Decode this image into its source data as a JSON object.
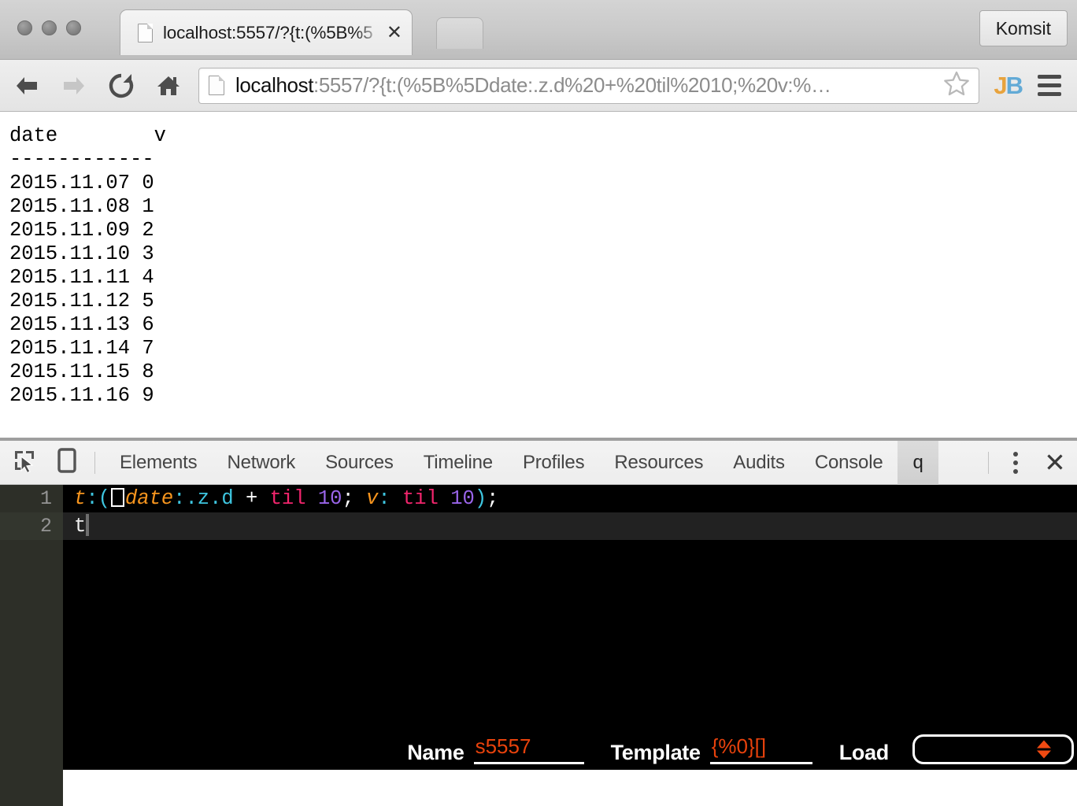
{
  "browser": {
    "traffic_lights": [
      "close",
      "minimize",
      "zoom"
    ],
    "tab": {
      "title": "localhost:5557/?{t:(%5B%5",
      "favicon": "document-icon",
      "close_label": "✕"
    },
    "profile_button_label": "Komsit",
    "toolbar": {
      "back_icon": "back-arrow-icon",
      "forward_icon": "forward-arrow-icon",
      "reload_icon": "reload-icon",
      "home_icon": "home-icon",
      "url_host": "localhost",
      "url_rest": ":5557/?{t:(%5B%5Ddate:.z.d%20+%20til%2010;%20v:%…",
      "url_full": "localhost:5557/?{t:(%5B%5Ddate:.z.d%20+%20til%2010;%20v:%…",
      "star_icon": "bookmark-star-icon",
      "extension_icon": "jb-extension-icon",
      "extension_text_j": "J",
      "extension_text_b": "B",
      "menu_icon": "hamburger-menu-icon"
    }
  },
  "page": {
    "table_text": "date        v\n------------\n2015.11.07 0\n2015.11.08 1\n2015.11.09 2\n2015.11.10 3\n2015.11.11 4\n2015.11.12 5\n2015.11.13 6\n2015.11.14 7\n2015.11.15 8\n2015.11.16 9",
    "columns": [
      "date",
      "v"
    ],
    "rows": [
      [
        "2015.11.07",
        "0"
      ],
      [
        "2015.11.08",
        "1"
      ],
      [
        "2015.11.09",
        "2"
      ],
      [
        "2015.11.10",
        "3"
      ],
      [
        "2015.11.11",
        "4"
      ],
      [
        "2015.11.12",
        "5"
      ],
      [
        "2015.11.13",
        "6"
      ],
      [
        "2015.11.14",
        "7"
      ],
      [
        "2015.11.15",
        "8"
      ],
      [
        "2015.11.16",
        "9"
      ]
    ]
  },
  "devtools": {
    "inspect_icon": "inspect-element-icon",
    "device_icon": "device-toolbar-icon",
    "tabs": [
      {
        "label": "Elements",
        "active": false
      },
      {
        "label": "Network",
        "active": false
      },
      {
        "label": "Sources",
        "active": false
      },
      {
        "label": "Timeline",
        "active": false
      },
      {
        "label": "Profiles",
        "active": false
      },
      {
        "label": "Resources",
        "active": false
      },
      {
        "label": "Audits",
        "active": false
      },
      {
        "label": "Console",
        "active": false
      },
      {
        "label": "q",
        "active": true
      }
    ],
    "kebab_icon": "more-options-icon",
    "close_icon": "close-devtools-icon",
    "editor": {
      "line1_number": "1",
      "line2_number": "2",
      "line1_tokens": {
        "t": "t",
        "colon1": ":",
        "paren_open": "(",
        "missing_glyph": "□",
        "date": "date",
        "colon2": ":",
        "zd": ".z.d",
        "plus": " + ",
        "til1": "til",
        "num1": "10",
        "semi1": "; ",
        "v": "v",
        "colon3": ":",
        "space": " ",
        "til2": "til",
        "num2": "10",
        "paren_close": ")",
        "semi2": ";"
      },
      "line1_plain": "t:(□date:.z.d + til 10; v: til 10);",
      "line2_text": "t"
    },
    "statusbar": {
      "name_label": "Name",
      "name_value": "s5557",
      "template_label": "Template",
      "template_value": "{%0}[]",
      "load_label": "Load",
      "load_value": "",
      "load_arrows_icon": "spinner-arrows-icon"
    }
  },
  "colors": {
    "accent_orange": "#e8420c",
    "token_var": "#f7951e",
    "token_punct": "#3ec6e0",
    "token_keyword": "#f2256d",
    "token_number": "#9a65ea",
    "editor_bg": "#000000",
    "gutter_bg": "#2d2f28"
  }
}
